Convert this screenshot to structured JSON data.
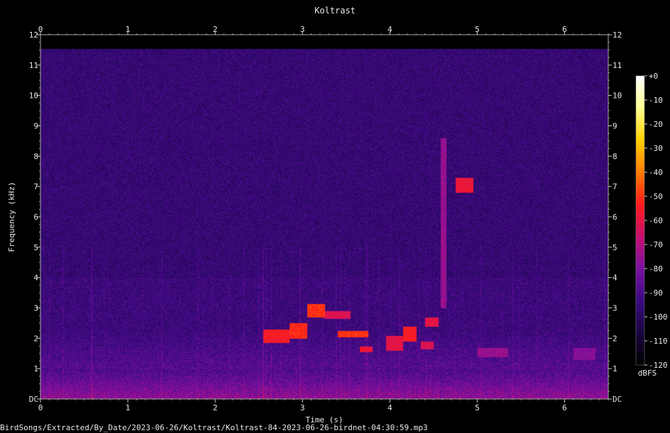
{
  "chart_data": {
    "type": "heatmap",
    "title": "Koltrast",
    "xlabel": "Time (s)",
    "ylabel": "Frequency (kHz)",
    "xlim": [
      0,
      6.5
    ],
    "ylim": [
      0,
      12
    ],
    "x_ticks": [
      {
        "value": 0,
        "label": "0"
      },
      {
        "value": 1,
        "label": "1"
      },
      {
        "value": 2,
        "label": "2"
      },
      {
        "value": 3,
        "label": "3"
      },
      {
        "value": 4,
        "label": "4"
      },
      {
        "value": 5,
        "label": "5"
      },
      {
        "value": 6,
        "label": "6"
      }
    ],
    "y_ticks": [
      {
        "value": 0,
        "label": "DC"
      },
      {
        "value": 1,
        "label": "1"
      },
      {
        "value": 2,
        "label": "2"
      },
      {
        "value": 3,
        "label": "3"
      },
      {
        "value": 4,
        "label": "4"
      },
      {
        "value": 5,
        "label": "5"
      },
      {
        "value": 6,
        "label": "6"
      },
      {
        "value": 7,
        "label": "7"
      },
      {
        "value": 8,
        "label": "8"
      },
      {
        "value": 9,
        "label": "9"
      },
      {
        "value": 10,
        "label": "10"
      },
      {
        "value": 11,
        "label": "11"
      },
      {
        "value": 12,
        "label": "12"
      }
    ],
    "colorbar": {
      "label": "dBFS",
      "range": [
        -120,
        0
      ],
      "ticks": [
        {
          "value": 0,
          "label": "+0"
        },
        {
          "value": -10,
          "label": "-10"
        },
        {
          "value": -20,
          "label": "-20"
        },
        {
          "value": -30,
          "label": "-30"
        },
        {
          "value": -40,
          "label": "-40"
        },
        {
          "value": -50,
          "label": "-50"
        },
        {
          "value": -60,
          "label": "-60"
        },
        {
          "value": -70,
          "label": "-70"
        },
        {
          "value": -80,
          "label": "-80"
        },
        {
          "value": -90,
          "label": "-90"
        },
        {
          "value": -100,
          "label": "-100"
        },
        {
          "value": -110,
          "label": "-110"
        },
        {
          "value": -120,
          "label": "-120"
        }
      ],
      "colors": [
        "#000000",
        "#1a0540",
        "#3a0a82",
        "#7a10a0",
        "#c81070",
        "#ff1a1a",
        "#ff7a00",
        "#ffd000",
        "#ffff90",
        "#ffffff"
      ]
    },
    "features": [
      {
        "t0": 2.55,
        "t1": 2.85,
        "f0": 1.85,
        "f1": 2.3,
        "db": -55
      },
      {
        "t0": 2.85,
        "t1": 3.05,
        "f0": 2.0,
        "f1": 2.5,
        "db": -52
      },
      {
        "t0": 3.05,
        "t1": 3.25,
        "f0": 2.7,
        "f1": 3.15,
        "db": -50
      },
      {
        "t0": 3.25,
        "t1": 3.55,
        "f0": 2.65,
        "f1": 2.9,
        "db": -62
      },
      {
        "t0": 3.4,
        "t1": 3.75,
        "f0": 2.05,
        "f1": 2.25,
        "db": -50
      },
      {
        "t0": 3.65,
        "t1": 3.8,
        "f0": 1.55,
        "f1": 1.75,
        "db": -58
      },
      {
        "t0": 3.95,
        "t1": 4.15,
        "f0": 1.6,
        "f1": 2.1,
        "db": -60
      },
      {
        "t0": 4.15,
        "t1": 4.3,
        "f0": 1.9,
        "f1": 2.4,
        "db": -55
      },
      {
        "t0": 4.35,
        "t1": 4.5,
        "f0": 1.65,
        "f1": 1.9,
        "db": -62
      },
      {
        "t0": 4.4,
        "t1": 4.55,
        "f0": 2.4,
        "f1": 2.7,
        "db": -60
      },
      {
        "t0": 4.75,
        "t1": 4.95,
        "f0": 6.8,
        "f1": 7.3,
        "db": -58
      },
      {
        "t0": 4.58,
        "t1": 4.64,
        "f0": 3.0,
        "f1": 8.6,
        "db": -75
      },
      {
        "t0": 5.0,
        "t1": 5.35,
        "f0": 1.4,
        "f1": 1.7,
        "db": -75
      },
      {
        "t0": 6.1,
        "t1": 6.35,
        "f0": 1.3,
        "f1": 1.7,
        "db": -78
      }
    ]
  },
  "footer_path": "BirdSongs/Extracted/By_Date/2023-06-26/Koltrast/Koltrast-84-2023-06-26-birdnet-04:30:59.mp3"
}
